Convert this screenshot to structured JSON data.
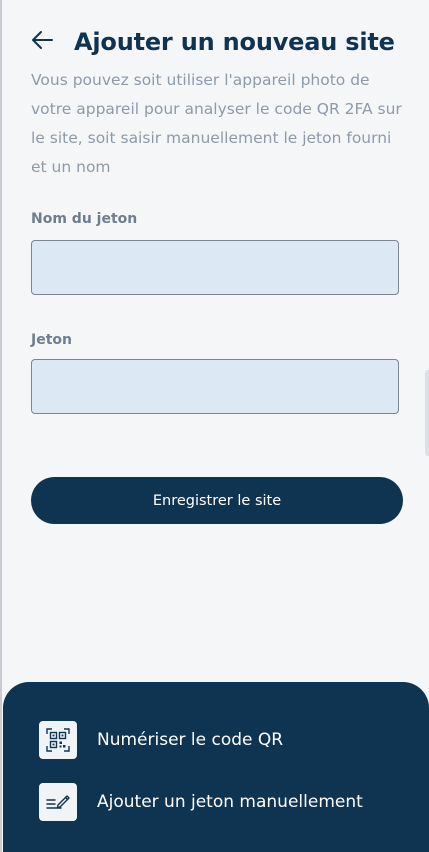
{
  "header": {
    "title": "Ajouter un nouveau site",
    "back_icon": "arrow-left-icon"
  },
  "description": "Vous pouvez soit utiliser l'appareil photo de votre appareil pour analyser le code QR 2FA sur le site, soit saisir manuellement le jeton fourni et un nom",
  "form": {
    "token_name_label": "Nom du jeton",
    "token_name_value": "",
    "token_label": "Jeton",
    "token_value": "",
    "save_label": "Enregistrer le site"
  },
  "sheet": {
    "actions": [
      {
        "label": "Numériser le code QR",
        "icon": "qr-code-icon"
      },
      {
        "label": "Ajouter un jeton manuellement",
        "icon": "edit-note-icon"
      }
    ]
  },
  "colors": {
    "primary": "#0e3452",
    "input_bg": "#dce8f3",
    "muted_text": "#8e9aa9",
    "background": "#f5f6f8"
  }
}
